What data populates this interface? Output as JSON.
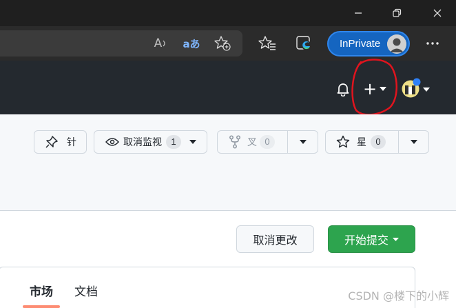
{
  "browser": {
    "window_controls": {
      "minimize": "minimize",
      "maximize": "maximize",
      "close": "close"
    },
    "toolbar": {
      "read_aloud_glyph": "A",
      "translate_glyph": "aあ",
      "inprivate_label": "InPrivate"
    }
  },
  "github": {
    "header": {
      "new_menu_glyph": "+"
    },
    "repo_actions": {
      "pin_label": "针",
      "watch_label": "取消监视",
      "watch_count": "1",
      "fork_label": "叉",
      "fork_count": "0",
      "star_label": "星",
      "star_count": "0"
    },
    "editor_actions": {
      "cancel_label": "取消更改",
      "commit_label": "开始提交"
    },
    "tabs": [
      {
        "label": "市场",
        "active": true
      },
      {
        "label": "文档",
        "active": false
      }
    ]
  },
  "watermark": "CSDN @楼下的小辉",
  "colors": {
    "header_bg": "#24292f",
    "primary_green": "#2da44e",
    "inprivate_blue": "#1565c0",
    "annotation_red": "#e0141e",
    "notification_dot": "#2f81f7"
  }
}
